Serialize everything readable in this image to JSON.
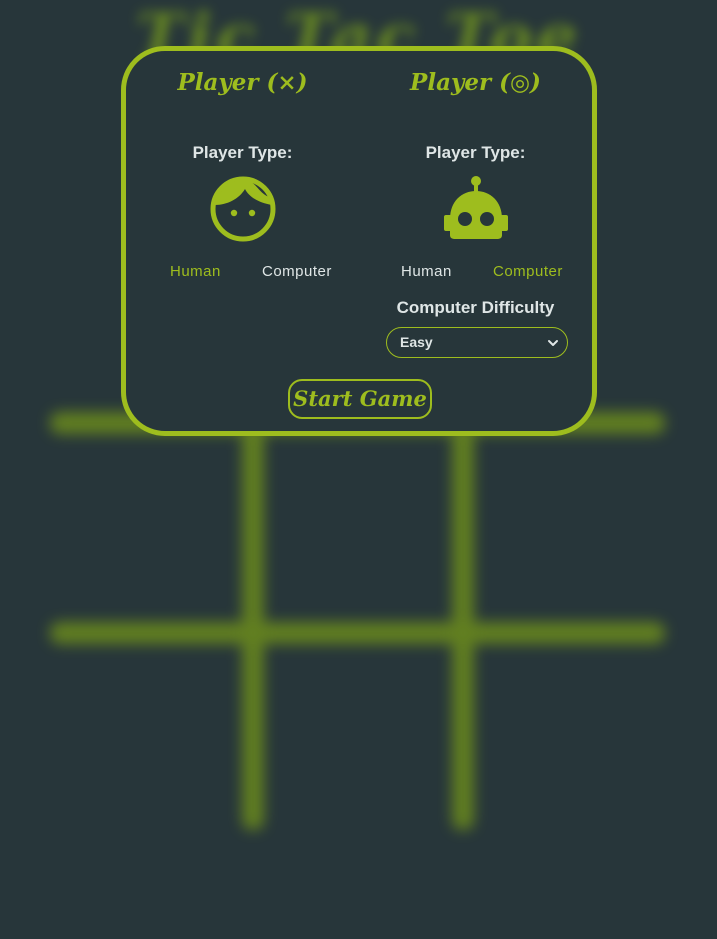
{
  "background": {
    "title": "Tic Tac Toe"
  },
  "modal": {
    "player_x": {
      "title": "Player (⨯)",
      "type_label": "Player Type:",
      "avatar_icon": "human-face-icon",
      "options": {
        "human": "Human",
        "computer": "Computer"
      },
      "selected": "human"
    },
    "player_o": {
      "title": "Player (◎)",
      "type_label": "Player Type:",
      "avatar_icon": "robot-icon",
      "options": {
        "human": "Human",
        "computer": "Computer"
      },
      "selected": "computer",
      "difficulty_label": "Computer Difficulty",
      "difficulty_value": "Easy"
    },
    "start_button": "Start Game"
  },
  "colors": {
    "accent": "#9ebd1e",
    "background": "#27363a",
    "text_light": "#dfe6e6"
  }
}
